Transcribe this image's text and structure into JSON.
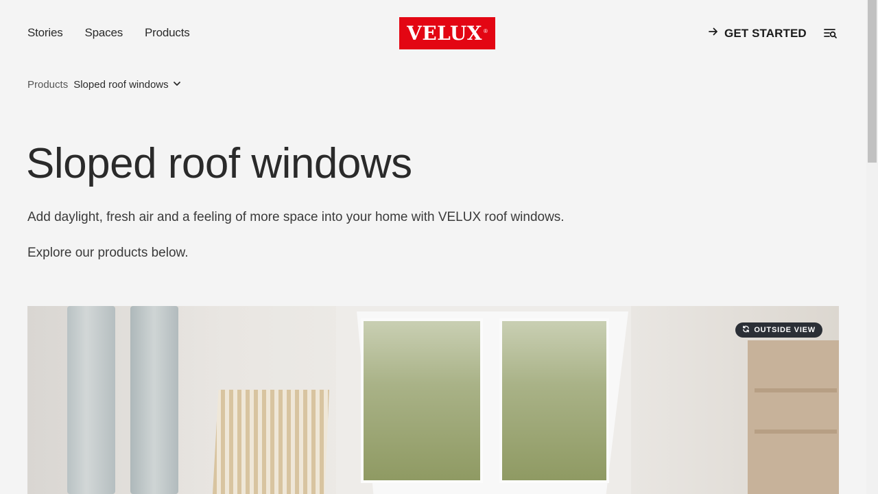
{
  "nav": {
    "links": [
      "Stories",
      "Spaces",
      "Products"
    ],
    "logo_text": "VELUX",
    "logo_mark": "®",
    "get_started_label": "GET STARTED",
    "get_started_icon": "arrow-right-icon",
    "menu_icon": "menu-search-icon"
  },
  "breadcrumb": {
    "parent": "Products",
    "current": "Sloped roof windows",
    "chevron_icon": "chevron-down-icon"
  },
  "hero": {
    "title": "Sloped roof windows",
    "intro": "Add daylight, fresh air and a feeling of more space into your home with VELUX roof windows.",
    "explore": "Explore our products below.",
    "image_badge": "OUTSIDE VIEW",
    "image_badge_icon": "refresh-icon"
  },
  "colors": {
    "brand_red": "#e30613",
    "background": "#f4f4f4",
    "badge_bg": "#2b2f36"
  }
}
